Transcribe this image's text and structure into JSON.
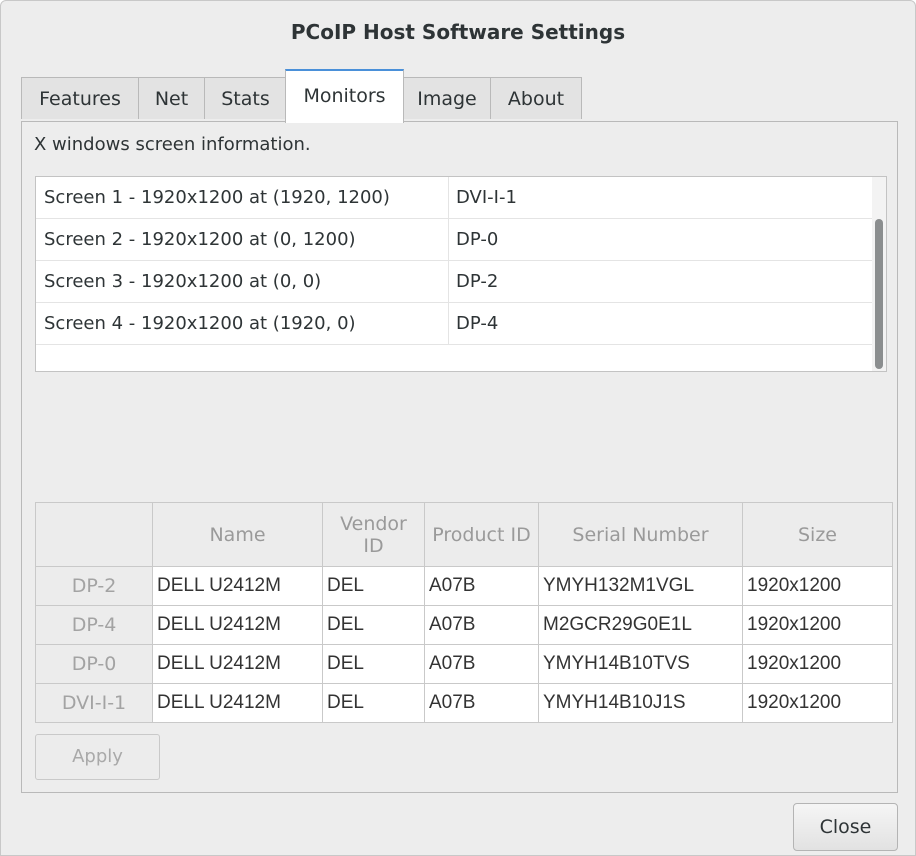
{
  "window": {
    "title": "PCoIP Host Software Settings"
  },
  "tabs": [
    {
      "label": "Features",
      "active": false
    },
    {
      "label": "Net",
      "active": false
    },
    {
      "label": "Stats",
      "active": false
    },
    {
      "label": "Monitors",
      "active": true
    },
    {
      "label": "Image",
      "active": false
    },
    {
      "label": "About",
      "active": false
    }
  ],
  "monitors": {
    "description": "X windows screen information.",
    "screens": [
      {
        "info": "Screen 1 - 1920x1200 at (1920, 1200)",
        "output": "DVI-I-1"
      },
      {
        "info": "Screen 2 - 1920x1200 at (0, 1200)",
        "output": "DP-0"
      },
      {
        "info": "Screen 3 - 1920x1200 at (0, 0)",
        "output": "DP-2"
      },
      {
        "info": "Screen 4 - 1920x1200 at (1920, 0)",
        "output": "DP-4"
      }
    ],
    "table": {
      "headers": [
        "",
        "Name",
        "Vendor ID",
        "Product ID",
        "Serial Number",
        "Size"
      ],
      "rows": [
        {
          "port": "DP-2",
          "name": "DELL U2412M",
          "vendor": "DEL",
          "product": "A07B",
          "serial": "YMYH132M1VGL",
          "size": "1920x1200"
        },
        {
          "port": "DP-4",
          "name": "DELL U2412M",
          "vendor": "DEL",
          "product": "A07B",
          "serial": "M2GCR29G0E1L",
          "size": "1920x1200"
        },
        {
          "port": "DP-0",
          "name": "DELL U2412M",
          "vendor": "DEL",
          "product": "A07B",
          "serial": "YMYH14B10TVS",
          "size": "1920x1200"
        },
        {
          "port": "DVI-I-1",
          "name": "DELL U2412M",
          "vendor": "DEL",
          "product": "A07B",
          "serial": "YMYH14B10J1S",
          "size": "1920x1200"
        }
      ]
    },
    "apply_label": "Apply"
  },
  "footer": {
    "close_label": "Close"
  },
  "colors": {
    "active_tab_accent": "#4a90d9",
    "window_bg": "#ededed"
  }
}
